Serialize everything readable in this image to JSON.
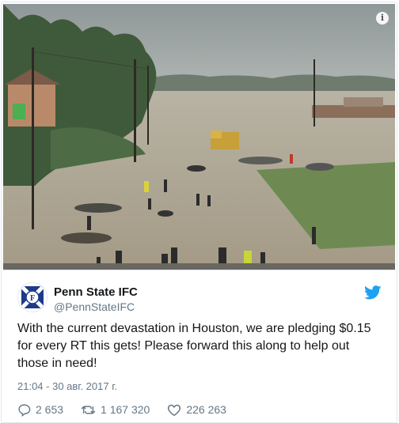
{
  "tweet": {
    "display_name": "Penn State IFC",
    "handle": "@PennStateIFC",
    "text": "With the current devastation in Houston, we are pledging $0.15 for every RT this gets! Please forward this along to help out those in need!",
    "timestamp": "21:04 - 30 авг. 2017 г.",
    "avatar_letter": "F",
    "media_icon": "info-icon"
  },
  "actions": {
    "replies": "2 653",
    "retweets": "1 167 320",
    "likes": "226 263"
  },
  "colors": {
    "twitter_blue": "#1da1f2",
    "secondary_text": "#657786",
    "avatar_blue": "#1e3a8a"
  }
}
